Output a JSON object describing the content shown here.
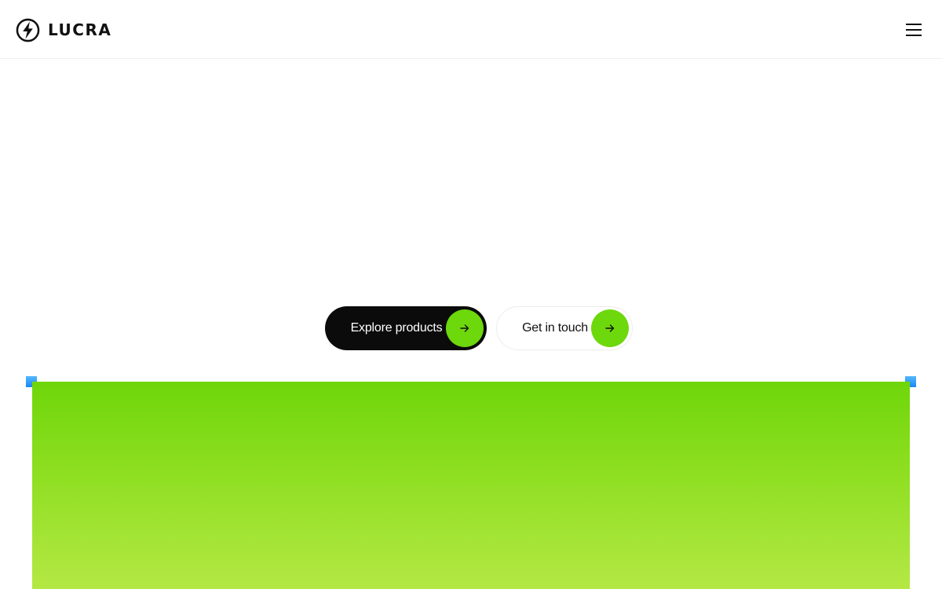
{
  "header": {
    "brand_name": "LUCRA",
    "logo_icon": "lightning-bolt-circle-icon",
    "menu_icon": "hamburger-menu-icon"
  },
  "cta": {
    "primary_label": "Explore products",
    "secondary_label": "Get in touch",
    "arrow_icon": "arrow-right-icon"
  },
  "colors": {
    "accent_green": "#6dd80c",
    "primary_button_bg": "#0b0b0b",
    "panel_gradient_top": "#6fd60a",
    "panel_gradient_bottom": "#b4e844",
    "handle_blue": "#1a86f0"
  }
}
